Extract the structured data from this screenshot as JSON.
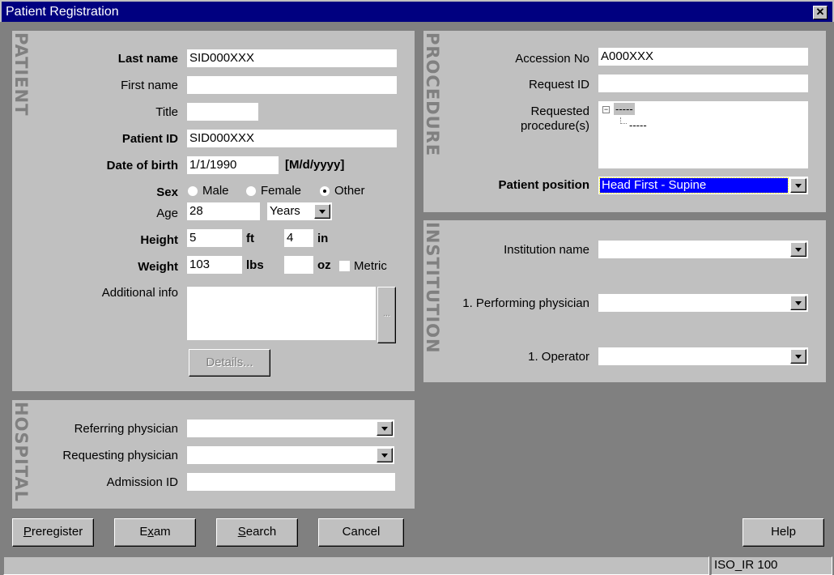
{
  "window": {
    "title": "Patient Registration",
    "close": "✕"
  },
  "patient": {
    "section": "PATIENT",
    "last_name_label": "Last name",
    "last_name": "SID000XXX",
    "first_name_label": "First name",
    "first_name": "",
    "title_label": "Title",
    "title": "",
    "patient_id_label": "Patient ID",
    "patient_id": "SID000XXX",
    "dob_label": "Date of birth",
    "dob": "1/1/1990",
    "dob_format": "[M/d/yyyy]",
    "sex_label": "Sex",
    "sex_options": [
      "Male",
      "Female",
      "Other"
    ],
    "sex_selected": "Other",
    "age_label": "Age",
    "age": "28",
    "age_unit": "Years",
    "height_label": "Height",
    "height_ft": "5",
    "ft": "ft",
    "height_in": "4",
    "in": "in",
    "weight_label": "Weight",
    "weight_lbs": "103",
    "lbs": "lbs",
    "weight_oz": "",
    "oz": "oz",
    "metric_label": "Metric",
    "metric_checked": false,
    "additional_info_label": "Additional info",
    "additional_info": "",
    "ellipsis": "...",
    "details_button": "Details..."
  },
  "hospital": {
    "section": "HOSPITAL",
    "referring_label": "Referring physician",
    "referring": "",
    "requesting_label": "Requesting physician",
    "requesting": "",
    "admission_label": "Admission ID",
    "admission": ""
  },
  "procedure": {
    "section": "PROCEDURE",
    "accession_label": "Accession No",
    "accession": "A000XXX",
    "request_id_label": "Request ID",
    "request_id": "",
    "requested_label_1": "Requested",
    "requested_label_2": "procedure(s)",
    "tree": {
      "root": "-----",
      "child": "-----"
    },
    "position_label": "Patient position",
    "position": "Head First - Supine"
  },
  "institution": {
    "section": "INSTITUTION",
    "institution_label": "Institution name",
    "institution": "",
    "performing_label": "1. Performing physician",
    "performing": "",
    "operator_label": "1. Operator",
    "operator": ""
  },
  "buttons": {
    "preregister_u": "P",
    "preregister": "reregister",
    "exam_1": "E",
    "exam_u": "x",
    "exam_2": "am",
    "search_u": "S",
    "search": "earch",
    "cancel": "Cancel",
    "help": "Help"
  },
  "status": {
    "left": "",
    "charset": "ISO_IR 100"
  },
  "colors": {
    "titlebar": "#000080",
    "selection": "#0000ff",
    "panel": "#c0c0c0",
    "background": "#808080"
  }
}
